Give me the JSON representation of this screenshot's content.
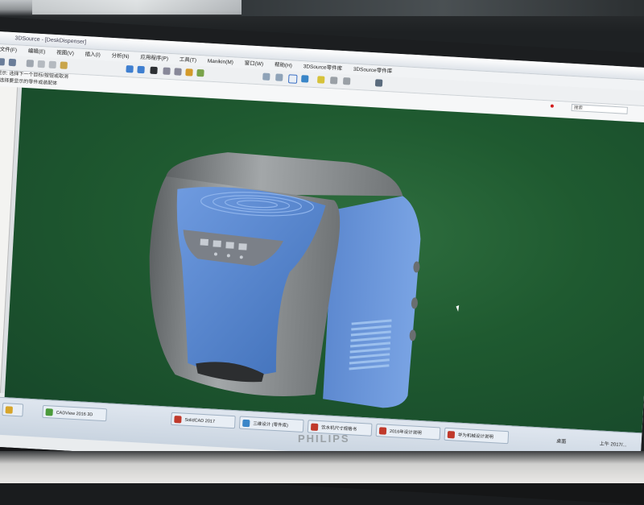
{
  "window": {
    "title": "3DSource - [DeskDispenser]",
    "menu": [
      "文件(F)",
      "编辑(E)",
      "视图(V)",
      "插入(I)",
      "分析(N)",
      "应用程序(P)",
      "工具(T)",
      "Manikin(M)",
      "窗口(W)",
      "帮助(H)",
      "3DSource零件库",
      "3DSource零件库"
    ]
  },
  "hint_lines": [
    "提示: 选择下一个目标/按钮或取消",
    "· 选择要显示的零件或装配体"
  ],
  "search": {
    "placeholder": "搜索"
  },
  "taskbar": {
    "items": [
      {
        "label": "",
        "color": "#2a6fd6"
      },
      {
        "label": "CADView 2016 3D",
        "color": "#4b9a3b"
      },
      {
        "label": "",
        "color": "#d7a52b"
      },
      {
        "label": "SolidCAD 2017",
        "color": "#c0392b"
      },
      {
        "label": "三维设计 (零件库)",
        "color": "#3a86c8"
      },
      {
        "label": "饮水机尺寸规格书",
        "color": "#c0392b"
      },
      {
        "label": "2016年设计说明",
        "color": "#c0392b"
      },
      {
        "label": "华为机械设计说明",
        "color": "#c0392b"
      }
    ],
    "tray_text": "桌面",
    "clock": "上午 2017/..."
  },
  "monitor_brand": "PHILIPS",
  "colors": {
    "viewport": "#1f5a30",
    "model_blue": "#5f8fd6",
    "model_gray": "#8f9395"
  }
}
